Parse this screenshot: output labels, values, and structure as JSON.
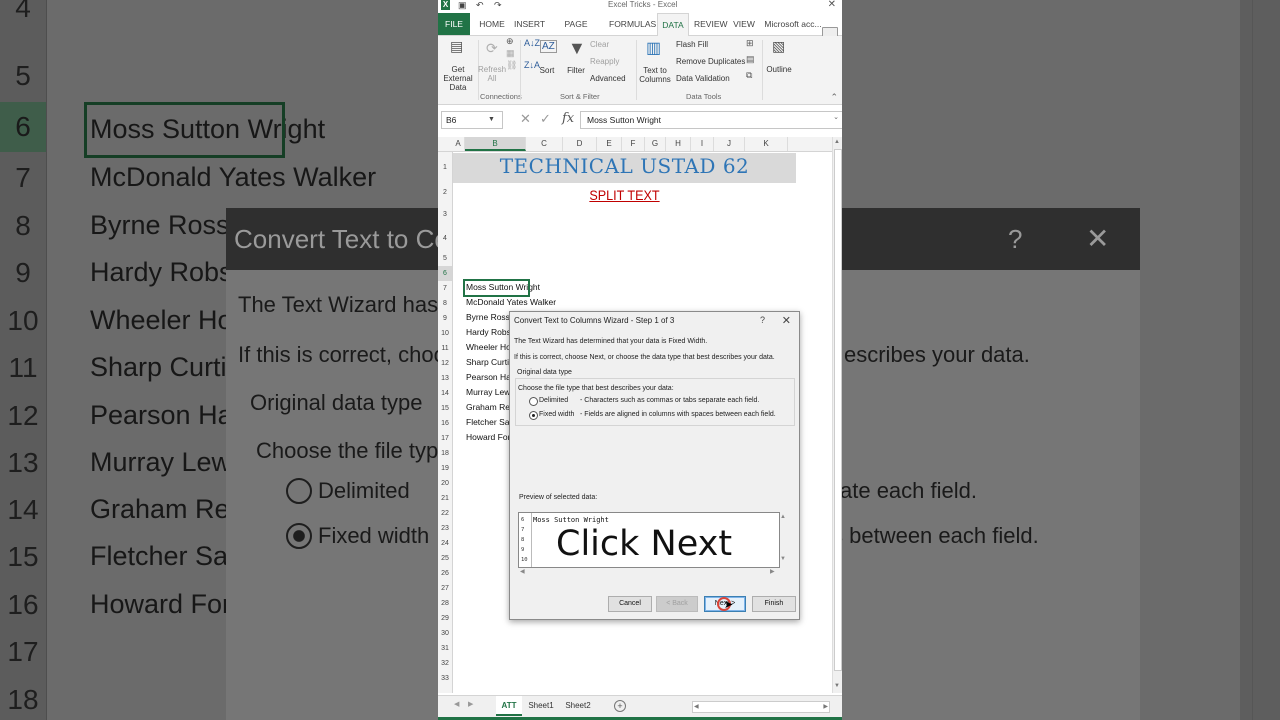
{
  "background": {
    "row_numbers": [
      "4",
      "5",
      "6",
      "7",
      "8",
      "9",
      "10",
      "11",
      "12",
      "13",
      "14",
      "15",
      "16",
      "17",
      "18"
    ],
    "names": [
      "Moss Sutton Wright",
      "McDonald Yates Walker",
      "Byrne Ross V",
      "Hardy Robso",
      "Wheeler Ho",
      "Sharp Curtis",
      "Pearson Han",
      "Murray Lewi",
      "Graham Rey",
      "Fletcher Sau",
      "Howard Ford"
    ],
    "dialog_title": "Convert Text to Colu",
    "dialog_help": "?",
    "dialog_close": "✕",
    "line1": "The Text Wizard has c",
    "line2": "If this is correct, choo",
    "line2_tail": "escribes your data.",
    "group_label": "Original data type",
    "choose": "Choose the file type",
    "delimited": "Delimited",
    "delimited_tail": "ate each field.",
    "fixed": "Fixed width",
    "fixed_tail": "s between each field."
  },
  "excel": {
    "window_title": "Excel Tricks - Excel",
    "tabs": [
      "FILE",
      "HOME",
      "INSERT",
      "PAGE LAYOUT",
      "FORMULAS",
      "DATA",
      "REVIEW",
      "VIEW",
      "Microsoft acc..."
    ],
    "active_tab": "DATA",
    "ribbon": {
      "get_external": "Get External Data",
      "refresh_all": "Refresh All",
      "connections_group": "Connections",
      "sort": "Sort",
      "filter": "Filter",
      "clear": "Clear",
      "reapply": "Reapply",
      "advanced": "Advanced",
      "sort_filter_group": "Sort & Filter",
      "text_to_columns": "Text to Columns",
      "flash_fill": "Flash Fill",
      "remove_duplicates": "Remove Duplicates",
      "data_validation": "Data Validation",
      "data_tools_group": "Data Tools",
      "outline": "Outline"
    },
    "name_box": "B6",
    "formula": "Moss Sutton Wright",
    "columns": [
      "A",
      "B",
      "C",
      "D",
      "E",
      "F",
      "G",
      "H",
      "I",
      "J",
      "K"
    ],
    "selected_column": "B",
    "rows": [
      "1",
      "2",
      "3",
      "4",
      "5",
      "6",
      "7",
      "8",
      "9",
      "10",
      "11",
      "12",
      "13",
      "14",
      "15",
      "16",
      "17",
      "18",
      "19",
      "20",
      "21",
      "22",
      "23",
      "24",
      "25",
      "26",
      "27",
      "28",
      "29",
      "30",
      "31",
      "32",
      "33"
    ],
    "selected_row": "6",
    "title": "TECHNICAL USTAD 62",
    "subtitle": "SPLIT TEXT",
    "names": [
      "Moss Sutton Wright",
      "McDonald Yates Walker",
      "Byrne Ross V",
      "Hardy Robso",
      "Wheeler Ho",
      "Sharp Curtis",
      "Pearson Han",
      "Murray Lewi",
      "Graham Rey",
      "Fletcher Sau",
      "Howard Ford"
    ],
    "sheets": [
      "ATT",
      "Sheet1",
      "Sheet2"
    ],
    "active_sheet": "ATT"
  },
  "dialog": {
    "title": "Convert Text to Columns Wizard - Step 1 of 3",
    "help": "?",
    "close": "✕",
    "line1": "The Text Wizard has determined that your data is Fixed Width.",
    "line2": "If this is correct, choose Next, or choose the data type that best describes your data.",
    "group_label": "Original data type",
    "choose": "Choose the file type that best describes your data:",
    "options": [
      {
        "label": "Delimited",
        "desc": "- Characters such as commas or tabs separate each field.",
        "selected": false
      },
      {
        "label": "Fixed width",
        "desc": "- Fields are aligned in columns with spaces between each field.",
        "selected": true
      }
    ],
    "preview_label": "Preview of selected data:",
    "preview_rows": [
      "6",
      "7",
      "8",
      "9",
      "10"
    ],
    "preview_line1": "Moss Sutton Wright",
    "buttons": {
      "cancel": "Cancel",
      "back": "< Back",
      "next": "Next >",
      "finish": "Finish"
    }
  },
  "overlay_caption": "Click Next"
}
